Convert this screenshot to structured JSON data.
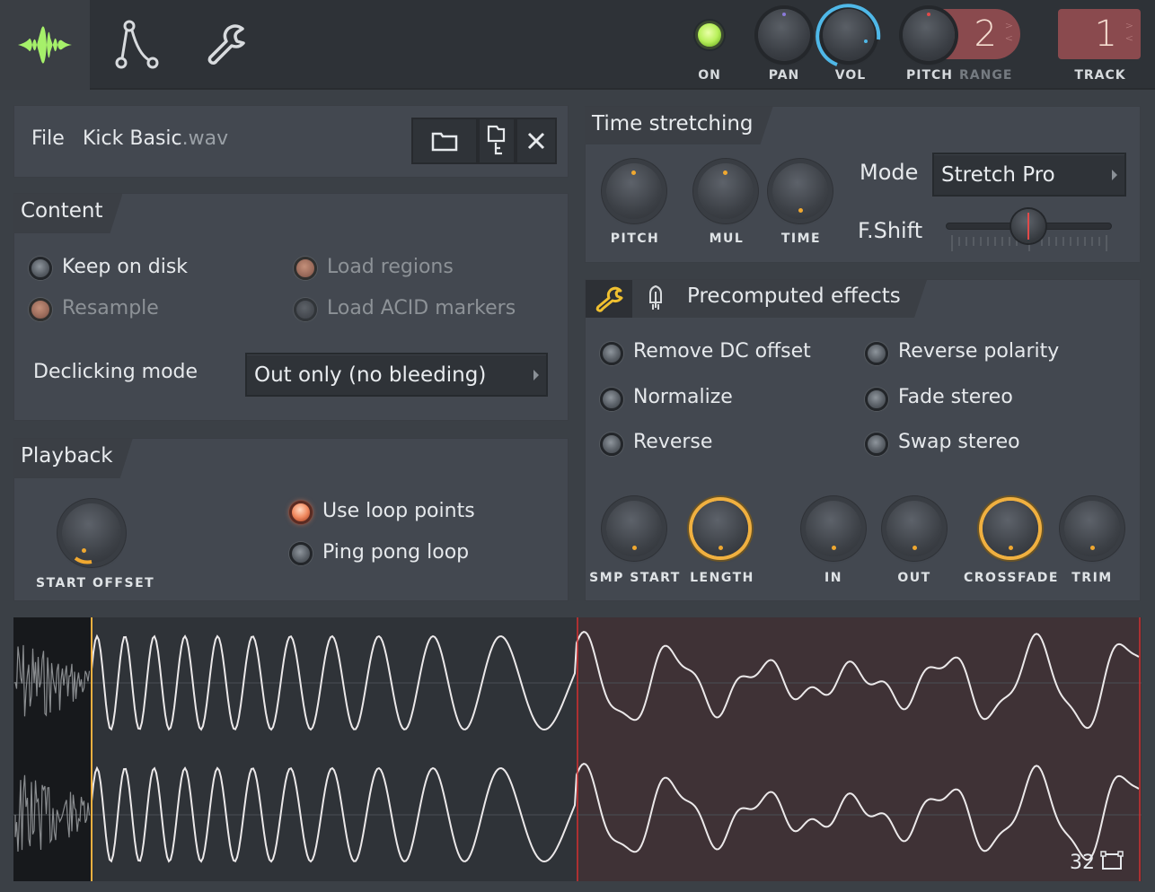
{
  "topbar": {
    "tabs": [
      {
        "icon": "waveform-icon",
        "active": true
      },
      {
        "icon": "envelope-icon",
        "active": false
      },
      {
        "icon": "wrench-icon",
        "active": false
      }
    ],
    "on_label": "ON",
    "pan_label": "PAN",
    "vol_label": "VOL",
    "pitch_label": "PITCH",
    "range_label": "RANGE",
    "range_value": "2",
    "track_label": "TRACK",
    "track_value": "1",
    "on_state": true,
    "accent_green": "#b8f05a",
    "vol_ring_color": "#4fb8e8"
  },
  "file": {
    "label": "File",
    "name": "Kick Basic",
    "ext": ".wav",
    "buttons": [
      "open-folder",
      "browse-file",
      "close"
    ]
  },
  "content": {
    "title": "Content",
    "options": [
      {
        "label": "Keep on disk",
        "state": "off",
        "enabled": true
      },
      {
        "label": "Load regions",
        "state": "on",
        "enabled": false
      },
      {
        "label": "Resample",
        "state": "on",
        "enabled": false
      },
      {
        "label": "Load ACID markers",
        "state": "off",
        "enabled": false
      }
    ],
    "declicking_label": "Declicking mode",
    "declicking_value": "Out only (no bleeding)"
  },
  "playback": {
    "title": "Playback",
    "knob_label": "START OFFSET",
    "use_loop_points": "Use loop points",
    "ping_pong_loop": "Ping pong loop",
    "use_loop_points_on": true,
    "ping_pong_loop_on": false
  },
  "time_stretching": {
    "title": "Time stretching",
    "knobs": [
      "PITCH",
      "MUL",
      "TIME"
    ],
    "mode_label": "Mode",
    "mode_value": "Stretch Pro",
    "fshift_label": "F.Shift"
  },
  "precomputed": {
    "title": "Precomputed effects",
    "options_left": [
      "Remove DC offset",
      "Normalize",
      "Reverse"
    ],
    "options_right": [
      "Reverse polarity",
      "Fade stereo",
      "Swap stereo"
    ],
    "knobs": [
      "SMP START",
      "LENGTH",
      "IN",
      "OUT",
      "CROSSFADE",
      "TRIM"
    ],
    "ring_color": "#f0b040"
  },
  "waveform": {
    "zoom_value": "32",
    "loop_region_color": "#3f3236",
    "start_marker_color": "#f0b040",
    "loop_marker_color": "#d03030"
  }
}
